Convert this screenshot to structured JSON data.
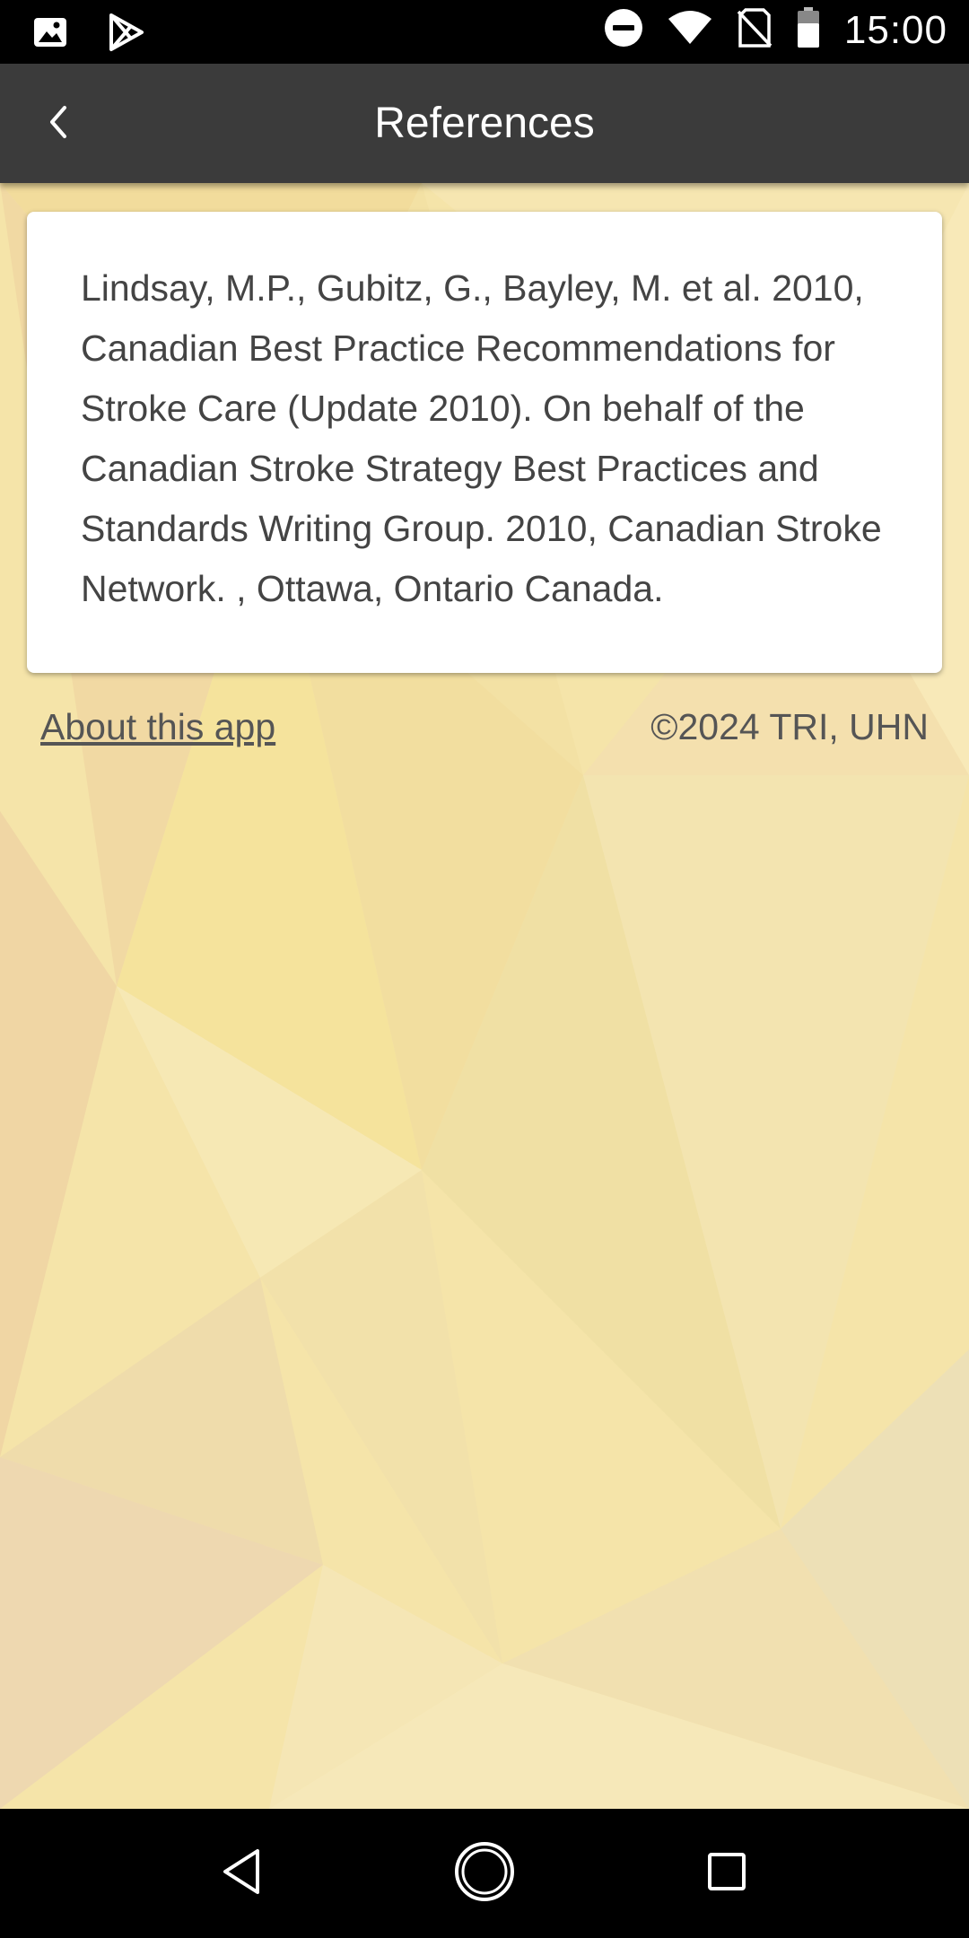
{
  "status_bar": {
    "time": "15:00",
    "icons": [
      "image-icon",
      "play-store-icon",
      "do-not-disturb-icon",
      "wifi-icon",
      "no-sim-icon",
      "battery-icon"
    ]
  },
  "header": {
    "title": "References",
    "back_icon": "chevron-left-icon"
  },
  "card": {
    "reference_text": "Lindsay, M.P., Gubitz, G., Bayley, M. et al. 2010, Canadian Best Practice Recommendations for Stroke Care (Update 2010). On behalf of the Canadian Stroke Strategy Best Practices and Standards Writing Group. 2010, Canadian Stroke Network. , Ottawa, Ontario Canada."
  },
  "footer": {
    "about_label": "About this app",
    "copyright": "©2024 TRI, UHN"
  },
  "nav_bar": {
    "icons": [
      "back-triangle-icon",
      "home-circle-icon",
      "recents-square-icon"
    ]
  },
  "colors": {
    "app_bar": "#3b3b3b",
    "background_accent": "#f4e3a8",
    "card": "#ffffff"
  }
}
